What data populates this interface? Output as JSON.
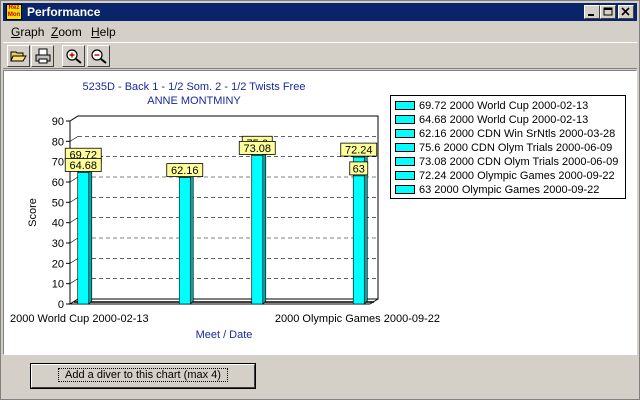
{
  "window": {
    "title": "Performance",
    "app_icon_text": "Rez Mon"
  },
  "menu": {
    "items": [
      {
        "label": "Graph",
        "accel": "G"
      },
      {
        "label": "Zoom",
        "accel": "Z"
      },
      {
        "label": "Help",
        "accel": "H"
      }
    ]
  },
  "toolbar": {
    "buttons": [
      "open-folder-icon",
      "print-icon",
      "zoom-in-icon",
      "zoom-out-icon"
    ]
  },
  "chart_data": {
    "type": "bar",
    "title": "5235D - Back 1 - 1/2 Som. 2 - 1/2 Twists Free",
    "subtitle": "ANNE MONTMINY",
    "xlabel": "Meet / Date",
    "ylabel": "Score",
    "ylim": [
      0,
      90
    ],
    "yticks": [
      0,
      10,
      20,
      30,
      40,
      50,
      60,
      70,
      80,
      90
    ],
    "x_tick_labels": [
      "2000 World Cup 2000-02-13",
      "2000 Olympic Games 2000-09-22"
    ],
    "grid": true,
    "legend_position": "right",
    "bar_color": "#00ffff",
    "series": [
      {
        "name": "2000 World Cup 2000-02-13",
        "value": 69.72,
        "label": "69.72",
        "legend": "69.72 2000 World Cup 2000-02-13"
      },
      {
        "name": "2000 World Cup 2000-02-13",
        "value": 64.68,
        "label": "64.68",
        "legend": "64.68 2000 World Cup 2000-02-13"
      },
      {
        "name": "2000 CDN Win SrNtls 2000-03-28",
        "value": 62.16,
        "label": "62.16",
        "legend": "62.16 2000 CDN Win SrNtls 2000-03-28"
      },
      {
        "name": "2000 CDN Olym Trials 2000-06-09",
        "value": 75.6,
        "label": "75.6",
        "legend": "75.6 2000 CDN Olym Trials 2000-06-09"
      },
      {
        "name": "2000 CDN Olym Trials 2000-06-09",
        "value": 73.08,
        "label": "73.08",
        "legend": "73.08 2000 CDN Olym Trials 2000-06-09"
      },
      {
        "name": "2000 Olympic Games 2000-09-22",
        "value": 72.24,
        "label": "72.24",
        "legend": "72.24 2000 Olympic Games 2000-09-22"
      },
      {
        "name": "2000 Olympic Games 2000-09-22",
        "value": 63,
        "label": "63",
        "legend": "63 2000 Olympic Games 2000-09-22"
      }
    ]
  },
  "bottom": {
    "add_button_label": "Add a diver to this chart (max 4)"
  }
}
